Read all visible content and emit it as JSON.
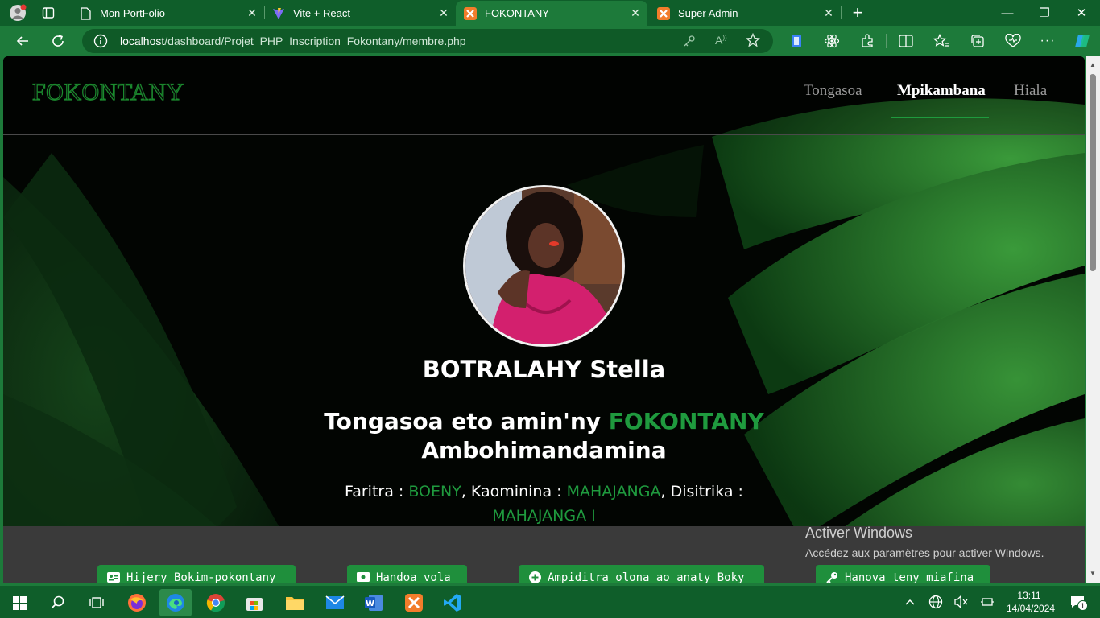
{
  "browser": {
    "tabs": [
      {
        "title": "Mon PortFolio",
        "icon": "page-icon"
      },
      {
        "title": "Vite + React",
        "icon": "vite-icon"
      },
      {
        "title": "FOKONTANY",
        "icon": "xampp-icon",
        "active": true
      },
      {
        "title": "Super Admin",
        "icon": "xampp-icon"
      }
    ],
    "new_tab_label": "+",
    "window_controls": {
      "minimize": "—",
      "restore": "❐",
      "close": "✕"
    },
    "address": {
      "host": "localhost",
      "path": "/dashboard/Projet_PHP_Inscription_Fokontany/membre.php"
    },
    "accent_color": "#1d7a3a"
  },
  "site": {
    "logo": "FOKONTANY",
    "nav": [
      "Tongasoa",
      "Mpikambana",
      "Hiala"
    ],
    "active_nav": "Mpikambana",
    "member": {
      "name": "BOTRALAHY Stella",
      "welcome_prefix": "Tongasoa eto amin'ny",
      "welcome_highlight": "FOKONTANY",
      "welcome_place": "Ambohimandamina",
      "faritra_label": "Faritra :",
      "faritra": "BOENY",
      "kaominina_label": ", Kaominina :",
      "kaominina": "MAHAJANGA",
      "disitrika_label": ", Disitrika :",
      "disitrika": "MAHAJANGA I"
    },
    "actions": [
      {
        "label": "Hijery Bokim-pokontany",
        "icon": "id-card-icon"
      },
      {
        "label": "Handoa vola",
        "icon": "money-icon"
      },
      {
        "label": "Ampiditra olona ao anaty Boky",
        "icon": "plus-circle-icon"
      },
      {
        "label": "Hanova teny miafina",
        "icon": "key-icon"
      }
    ],
    "highlight_color": "#1f9a3e"
  },
  "windows_activation": {
    "title": "Activer Windows",
    "subtitle": "Accédez aux paramètres pour activer Windows."
  },
  "taskbar": {
    "time": "13:11",
    "date": "14/04/2024",
    "notification_count": "1"
  }
}
